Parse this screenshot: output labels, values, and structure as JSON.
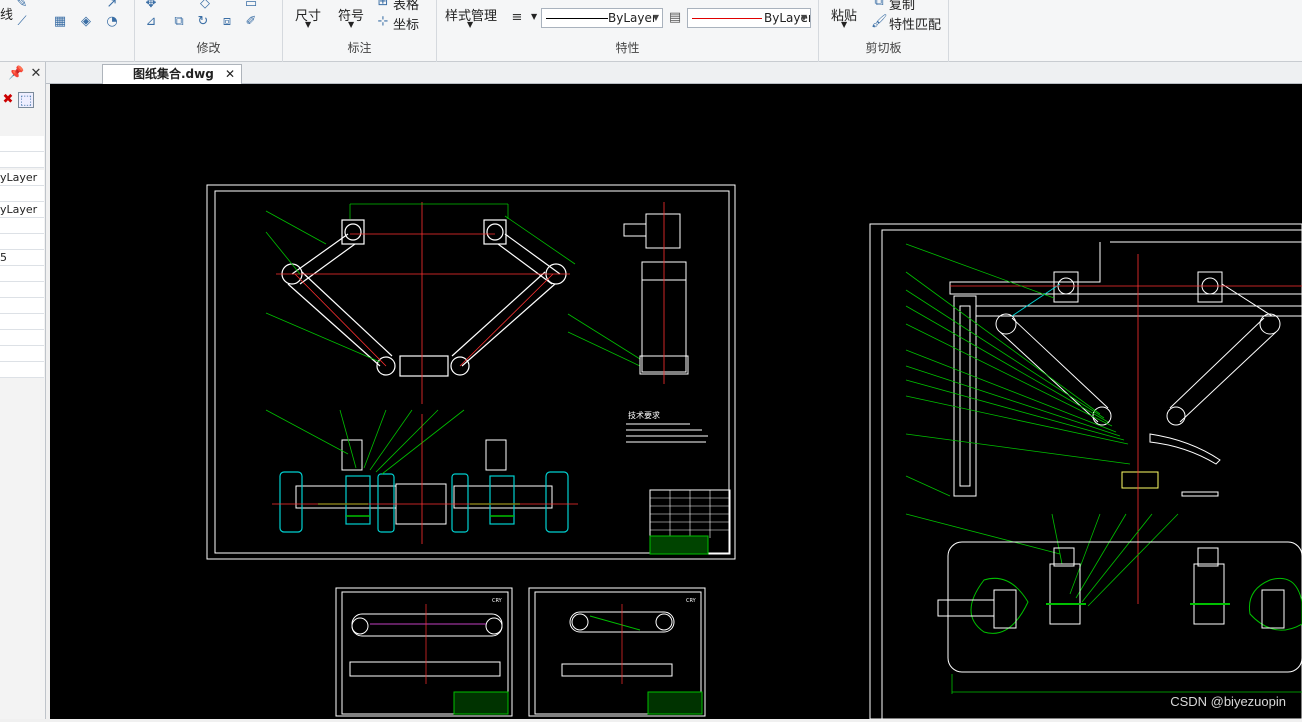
{
  "ribbon": {
    "modify": {
      "label": "修改"
    },
    "annotate": {
      "label": "标注",
      "dim_label": "尺寸",
      "symbol_label": "符号",
      "table_label": "表格",
      "coord_label": "坐标"
    },
    "properties": {
      "label": "特性",
      "style_manager": "样式管理",
      "linetype_value": "ByLayer",
      "color_value": "ByLayer"
    },
    "clipboard": {
      "label": "剪切板",
      "paste_label": "粘贴",
      "copy_label": "复制",
      "match_label": "特性匹配"
    },
    "line_label": "线"
  },
  "left_panel": {
    "rows": [
      "yLayer",
      "yLayer",
      "5"
    ]
  },
  "tab": {
    "filename": "图纸集合.dwg"
  },
  "drawing": {
    "tech_req_label": "技术要求",
    "small_label_1": "CRY",
    "small_label_2": "CRY"
  },
  "watermark": "CSDN @biyezuopin",
  "colors": {
    "canvas": "#000000",
    "green": "#00c000",
    "red": "#ff3030",
    "white": "#ffffff",
    "cyan": "#00d0d0"
  }
}
